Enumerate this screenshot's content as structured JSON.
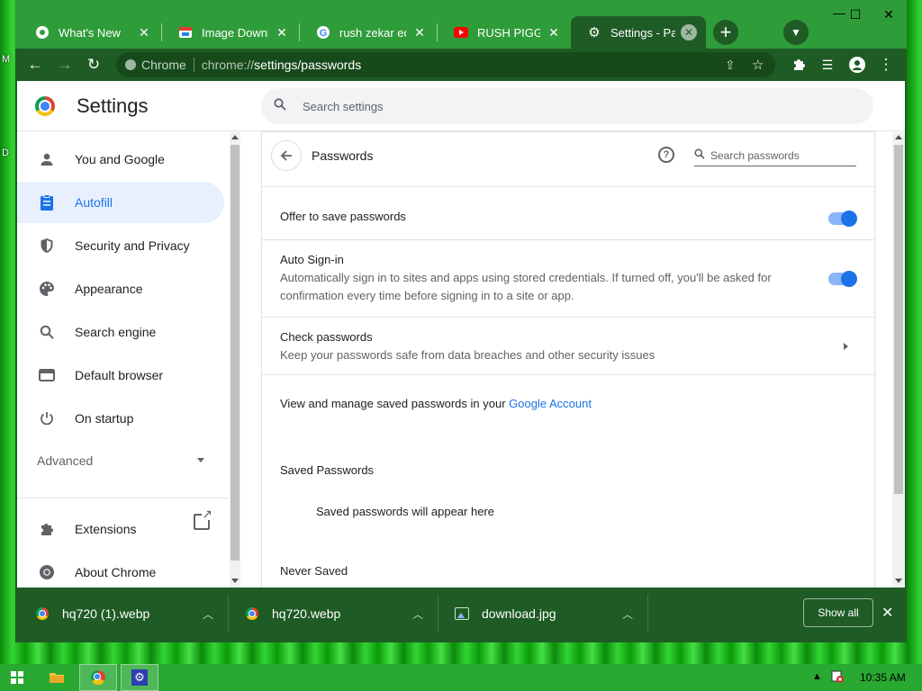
{
  "desktop": {
    "left_chars": [
      "M",
      "D"
    ]
  },
  "tabs": [
    {
      "title": "What's New",
      "icon": "chrome-icon"
    },
    {
      "title": "Image Downloader",
      "icon": "image-downloader-icon"
    },
    {
      "title": "rush zekar edited",
      "icon": "google-icon"
    },
    {
      "title": "RUSH PIGGIES - YouTube",
      "icon": "youtube-icon"
    },
    {
      "title": "Settings - Passwords",
      "icon": "gear-icon"
    }
  ],
  "window_controls": {
    "minimize": "—",
    "maximize": "☐",
    "close": "✕"
  },
  "omnibox": {
    "site": "Chrome",
    "url_prefix": "chrome://",
    "url_path": "settings/passwords"
  },
  "settings": {
    "title": "Settings",
    "search_placeholder": "Search settings",
    "nav": [
      {
        "label": "You and Google",
        "icon": "person-icon"
      },
      {
        "label": "Autofill",
        "icon": "clipboard-icon",
        "selected": true
      },
      {
        "label": "Security and Privacy",
        "icon": "shield-icon"
      },
      {
        "label": "Appearance",
        "icon": "palette-icon"
      },
      {
        "label": "Search engine",
        "icon": "search-icon"
      },
      {
        "label": "Default browser",
        "icon": "browser-icon"
      },
      {
        "label": "On startup",
        "icon": "power-icon"
      }
    ],
    "advanced": "Advanced",
    "extensions": "Extensions",
    "about": "About Chrome"
  },
  "passwords": {
    "title": "Passwords",
    "search_placeholder": "Search passwords",
    "offer_to_save": {
      "label": "Offer to save passwords",
      "enabled": true
    },
    "auto_signin": {
      "label": "Auto Sign-in",
      "desc_line1": "Automatically sign in to sites and apps using stored credentials. If turned off, you'll be asked for",
      "desc_line2": "confirmation every time before signing in to a site or app.",
      "enabled": true
    },
    "check": {
      "label": "Check passwords",
      "desc": "Keep your passwords safe from data breaches and other security issues"
    },
    "manage_text": "View and manage saved passwords in your ",
    "manage_link": "Google Account",
    "saved_header": "Saved Passwords",
    "saved_empty": "Saved passwords will appear here",
    "never_saved_header": "Never Saved"
  },
  "downloads": {
    "items": [
      {
        "name": "hq720 (1).webp",
        "icon": "chrome-icon"
      },
      {
        "name": "hq720.webp",
        "icon": "chrome-icon"
      },
      {
        "name": "download.jpg",
        "icon": "image-file-icon"
      }
    ],
    "show_all": "Show all"
  },
  "taskbar": {
    "time": "10:35 AM"
  },
  "colors": {
    "frame": "#1f5b24",
    "tabstrip": "#2f9c3a",
    "accent": "#1a73e8",
    "selected_bg": "#e8f0fe"
  }
}
